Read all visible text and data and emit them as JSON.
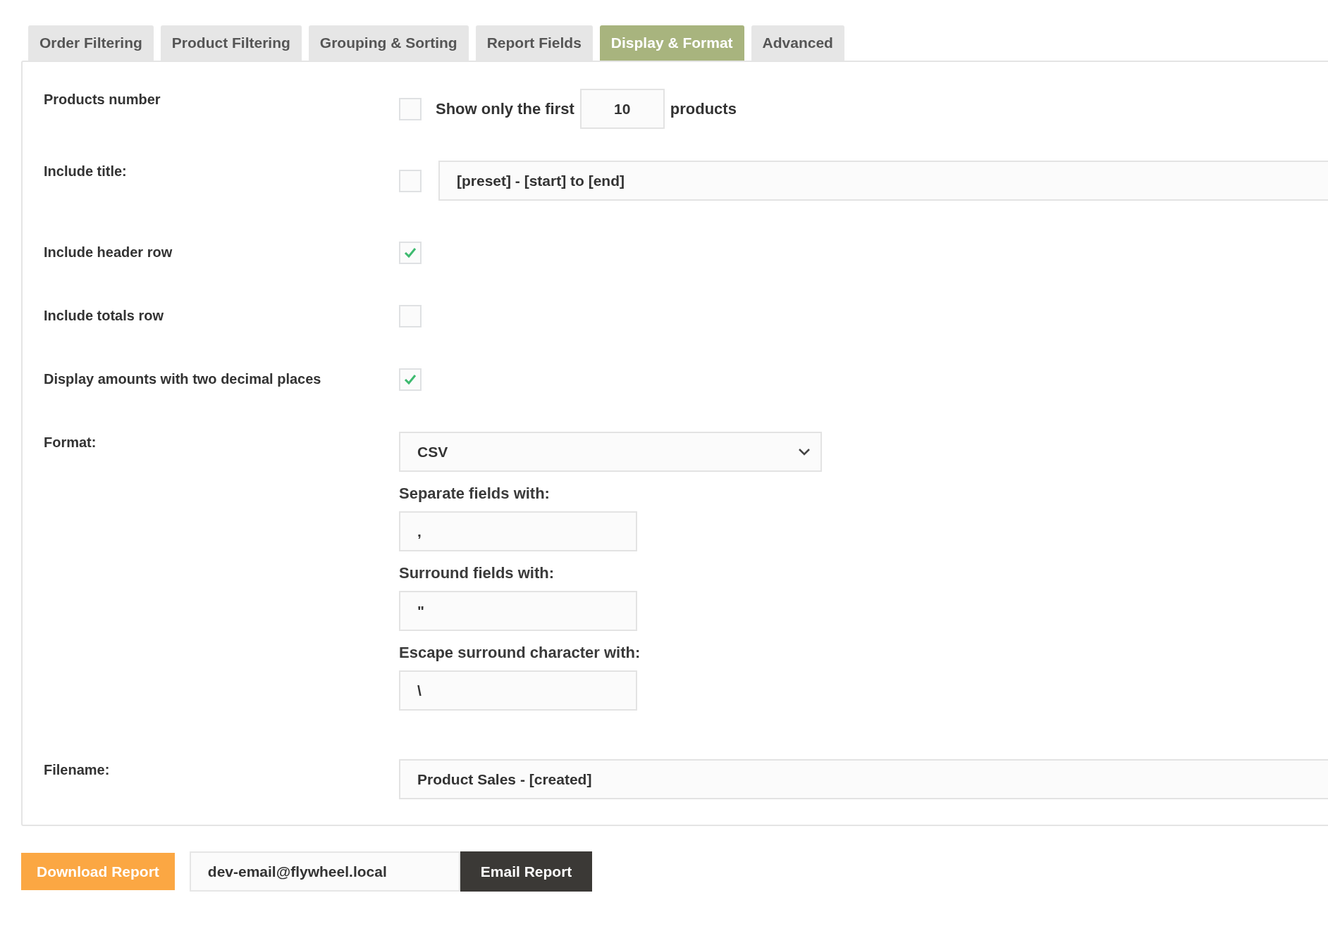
{
  "tabs": [
    {
      "label": "Order Filtering",
      "selected": false
    },
    {
      "label": "Product Filtering",
      "selected": false
    },
    {
      "label": "Grouping & Sorting",
      "selected": false
    },
    {
      "label": "Report Fields",
      "selected": false
    },
    {
      "label": "Display & Format",
      "selected": true
    },
    {
      "label": "Advanced",
      "selected": false
    }
  ],
  "settings": [
    {
      "kind": "limit",
      "label": "Products number",
      "checked": false,
      "prefix": "Show only the first",
      "value": "10",
      "suffix": "products"
    },
    {
      "kind": "title",
      "label": "Include title:",
      "checked": false,
      "value": "[preset] - [start] to [end]"
    },
    {
      "kind": "checkbox",
      "label": "Include header row",
      "checked": true
    },
    {
      "kind": "checkbox",
      "label": "Include totals row",
      "checked": false
    },
    {
      "kind": "checkbox",
      "label": "Display amounts with two decimal places",
      "checked": true
    },
    {
      "kind": "format",
      "label": "Format:",
      "value": "CSV",
      "fields": [
        {
          "label": "Separate fields with:",
          "value": ","
        },
        {
          "label": "Surround fields with:",
          "value": "\""
        },
        {
          "label": "Escape surround character with:",
          "value": "\\"
        }
      ]
    },
    {
      "kind": "text",
      "label": "Filename:",
      "value": "Product Sales - [created]"
    }
  ],
  "actions": {
    "download": "Download Report",
    "email": "dev-email@flywheel.local",
    "send": "Email Report"
  }
}
